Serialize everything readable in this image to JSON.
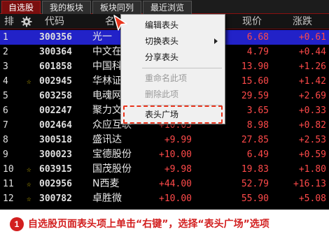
{
  "tabs": [
    {
      "label": "自选股",
      "active": true
    },
    {
      "label": "我的板块",
      "active": false
    },
    {
      "label": "板块同列",
      "active": false
    },
    {
      "label": "最近浏览",
      "active": false
    }
  ],
  "header": {
    "sort_label": "排",
    "settings_icon": "gear-icon",
    "code_label": "代码",
    "name_label": "名",
    "price_label": "现价",
    "change_label": "涨跌"
  },
  "rows": [
    {
      "idx": "1",
      "mark": "",
      "code": "300356",
      "name": "光一",
      "chg": "",
      "price": "6.68",
      "delta": "+0.61"
    },
    {
      "idx": "2",
      "mark": "",
      "code": "300364",
      "name": "中文在",
      "chg": "",
      "price": "4.79",
      "delta": "+0.44"
    },
    {
      "idx": "3",
      "mark": "",
      "code": "601858",
      "name": "中国科",
      "chg": "",
      "price": "13.90",
      "delta": "+1.26"
    },
    {
      "idx": "4",
      "mark": "☆",
      "code": "002945",
      "name": "华林证",
      "chg": "",
      "price": "15.60",
      "delta": "+1.42"
    },
    {
      "idx": "5",
      "mark": "",
      "code": "603258",
      "name": "电魂网",
      "chg": "",
      "price": "29.59",
      "delta": "+2.69"
    },
    {
      "idx": "6",
      "mark": "",
      "code": "002247",
      "name": "聚力文",
      "chg": "",
      "price": "3.65",
      "delta": "+0.33"
    },
    {
      "idx": "7",
      "mark": "",
      "code": "002464",
      "name": "众应互联",
      "chg": "+10.05",
      "price": "8.98",
      "delta": "+0.82"
    },
    {
      "idx": "8",
      "mark": "",
      "code": "300518",
      "name": "盛讯达",
      "chg": "+9.99",
      "price": "27.85",
      "delta": "+2.53"
    },
    {
      "idx": "9",
      "mark": "",
      "code": "300023",
      "name": "宝德股份",
      "chg": "+10.00",
      "price": "6.49",
      "delta": "+0.59"
    },
    {
      "idx": "10",
      "mark": "☆",
      "code": "603915",
      "name": "国茂股份",
      "chg": "+9.98",
      "price": "19.83",
      "delta": "+1.80"
    },
    {
      "idx": "11",
      "mark": "☆",
      "code": "002956",
      "name": "N西麦",
      "chg": "+44.00",
      "price": "52.79",
      "delta": "+16.13"
    },
    {
      "idx": "12",
      "mark": "☆",
      "code": "300782",
      "name": "卓胜微",
      "chg": "+10.00",
      "price": "55.90",
      "delta": "+5.08"
    }
  ],
  "context_menu": {
    "items": [
      {
        "label": "编辑表头",
        "submenu": false,
        "disabled": false
      },
      {
        "label": "切换表头",
        "submenu": true,
        "disabled": false
      },
      {
        "label": "分享表头",
        "submenu": false,
        "disabled": false
      },
      {
        "label": "重命名此项",
        "submenu": false,
        "disabled": true
      },
      {
        "label": "删除此项",
        "submenu": false,
        "disabled": true
      },
      {
        "label": "表头广场",
        "submenu": false,
        "disabled": false,
        "highlighted": true
      }
    ]
  },
  "caption": {
    "number": "1",
    "text": "自选股页面表头项上单击“右键”，选择“表头广场”选项"
  },
  "colors": {
    "up": "#ff4a4a",
    "selected_row": "#2222c8",
    "accent": "#d21f1f"
  }
}
